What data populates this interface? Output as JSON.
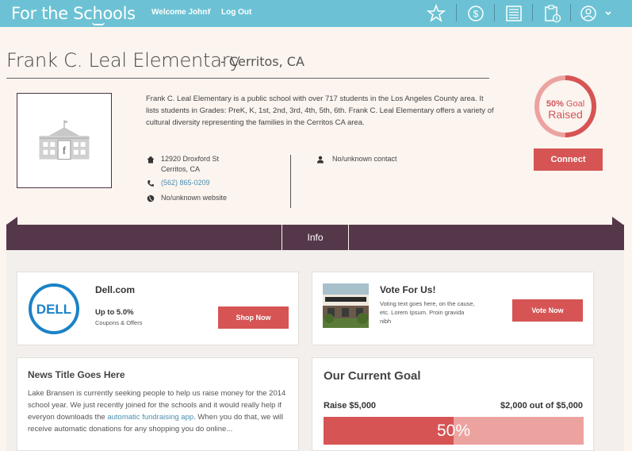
{
  "nav": {
    "logo": "For the Schools",
    "welcome": "Welcome John!",
    "separator": "/",
    "logout": "Log Out",
    "icons": [
      "star-icon",
      "dollar-icon",
      "list-icon",
      "clipboard-icon",
      "user-icon",
      "chevron-down-icon"
    ]
  },
  "school": {
    "name": "Frank C. Leal Elementary",
    "city": "- Cerritos, CA",
    "description": "Frank C. Leal Elementary is a public school with over 717 students in the Los Angeles County area. It lists students in Grades: PreK, K, 1st, 2nd, 3rd, 4th, 5th, 6th. Frank C. Leal Elementary offers a variety of cultural diversity representing the families in the Cerritos CA area.",
    "address_line1": "12920 Droxford St",
    "address_line2": "Cerritos, CA",
    "phone": "(562) 865-0209",
    "website": "No/unknown website",
    "contact": "No/unknown contact",
    "image_letter": "f"
  },
  "goal_badge": {
    "percent_label": "50%",
    "goal_word": "Goal",
    "raised_word": "Raised",
    "fraction": 0.5
  },
  "connect_label": "Connect",
  "tabs": {
    "info": "Info"
  },
  "dell": {
    "title": "Dell.com",
    "logo_text": "DELL",
    "rate": "Up to 5.0%",
    "sub": "Coupons & Offers",
    "button": "Shop Now"
  },
  "vote": {
    "title": "Vote For Us!",
    "body": "Voting text goes here, on the cause, etc. Lorem Ipsum. Proin gravida nibh",
    "button": "Vote Now"
  },
  "news": {
    "title": "News Title Goes Here",
    "body_before": "Lake Bransen is currently seeking people to help us raise money for the 2014 school year. We just recently joined for the schools and it would really help if everyon downloads the ",
    "link": "automatic fundraising app",
    "body_after": ". When you do that, we will receive automatic donations for any shopping you do online..."
  },
  "current_goal": {
    "title": "Our Current Goal",
    "raise_label": "Raise $5,000",
    "progress_label": "$2,000 out of $5,000",
    "percent_label": "50%",
    "fraction": 0.5
  },
  "colors": {
    "header": "#6cc2d4",
    "accent": "#d65454",
    "tabbar": "#55374a",
    "progress_track": "#eca3a0"
  }
}
